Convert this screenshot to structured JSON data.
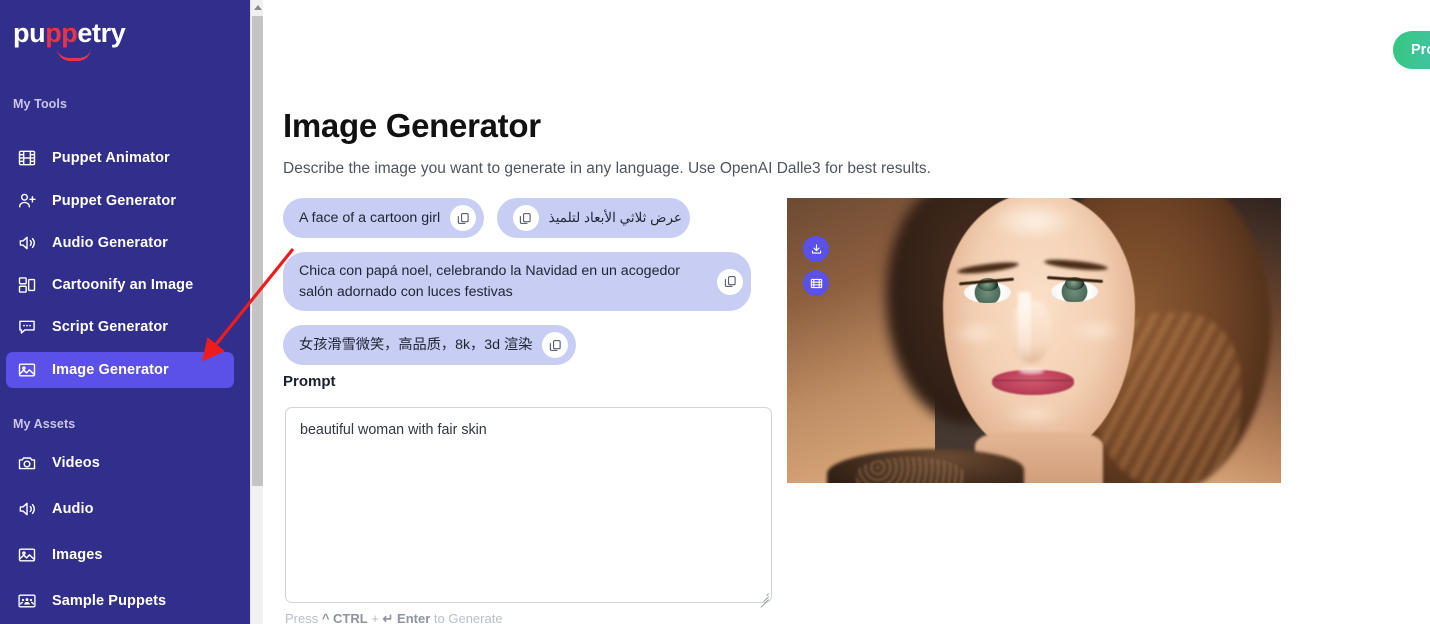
{
  "brand": {
    "name_part1": "pu",
    "name_accent": "pp",
    "name_part2": "etry",
    "accent_color": "#e8344a",
    "sidebar_color": "#312e8c",
    "active_color": "#5b51e8"
  },
  "sidebar": {
    "sections": [
      {
        "label": "My Tools"
      },
      {
        "label": "My Assets"
      }
    ],
    "tools": [
      {
        "label": "Puppet Animator",
        "icon": "film-icon",
        "active": false
      },
      {
        "label": "Puppet Generator",
        "icon": "user-plus-icon",
        "active": false
      },
      {
        "label": "Audio Generator",
        "icon": "speaker-icon",
        "active": false
      },
      {
        "label": "Cartoonify an Image",
        "icon": "layout-icon",
        "active": false
      },
      {
        "label": "Script Generator",
        "icon": "chat-bubble-icon",
        "active": false
      },
      {
        "label": "Image Generator",
        "icon": "image-icon",
        "active": true
      }
    ],
    "assets": [
      {
        "label": "Videos",
        "icon": "camera-icon"
      },
      {
        "label": "Audio",
        "icon": "speaker-icon"
      },
      {
        "label": "Images",
        "icon": "image-icon"
      },
      {
        "label": "Sample Puppets",
        "icon": "group-icon"
      }
    ]
  },
  "header": {
    "pro_button_label": "Pro"
  },
  "main": {
    "title": "Image Generator",
    "subtitle": "Describe the image you want to generate in any language. Use OpenAI Dalle3 for best results."
  },
  "suggestions": [
    {
      "text": "A face of a cartoon girl",
      "dir": "ltr",
      "copy_icon": "copy-icon"
    },
    {
      "text": "عرض ثلاثي الأبعاد لتلميذ",
      "dir": "rtl",
      "copy_icon": "copy-icon"
    },
    {
      "text": "Chica con papá noel, celebrando la Navidad en un acogedor salón adornado con luces festivas",
      "dir": "ltr",
      "copy_icon": "copy-icon"
    },
    {
      "text": "女孩滑雪微笑，高品质，8k，3d 渲染",
      "dir": "ltr",
      "copy_icon": "copy-icon"
    }
  ],
  "prompt": {
    "label": "Prompt",
    "value": "beautiful woman with fair skin",
    "placeholder": "",
    "hint_prefix": "Press ",
    "hint_ctrl": "^ CTRL",
    "hint_plus": " + ",
    "hint_enter": "↵ Enter",
    "hint_suffix": " to Generate"
  },
  "preview": {
    "alt": "generated portrait of a smiling woman with long brown hair",
    "actions": [
      {
        "name": "download-button",
        "icon": "download-icon"
      },
      {
        "name": "make-video-button",
        "icon": "film-icon"
      }
    ]
  },
  "annotation": {
    "arrow_color": "#ef1c1c",
    "points_to": "Image Generator"
  }
}
